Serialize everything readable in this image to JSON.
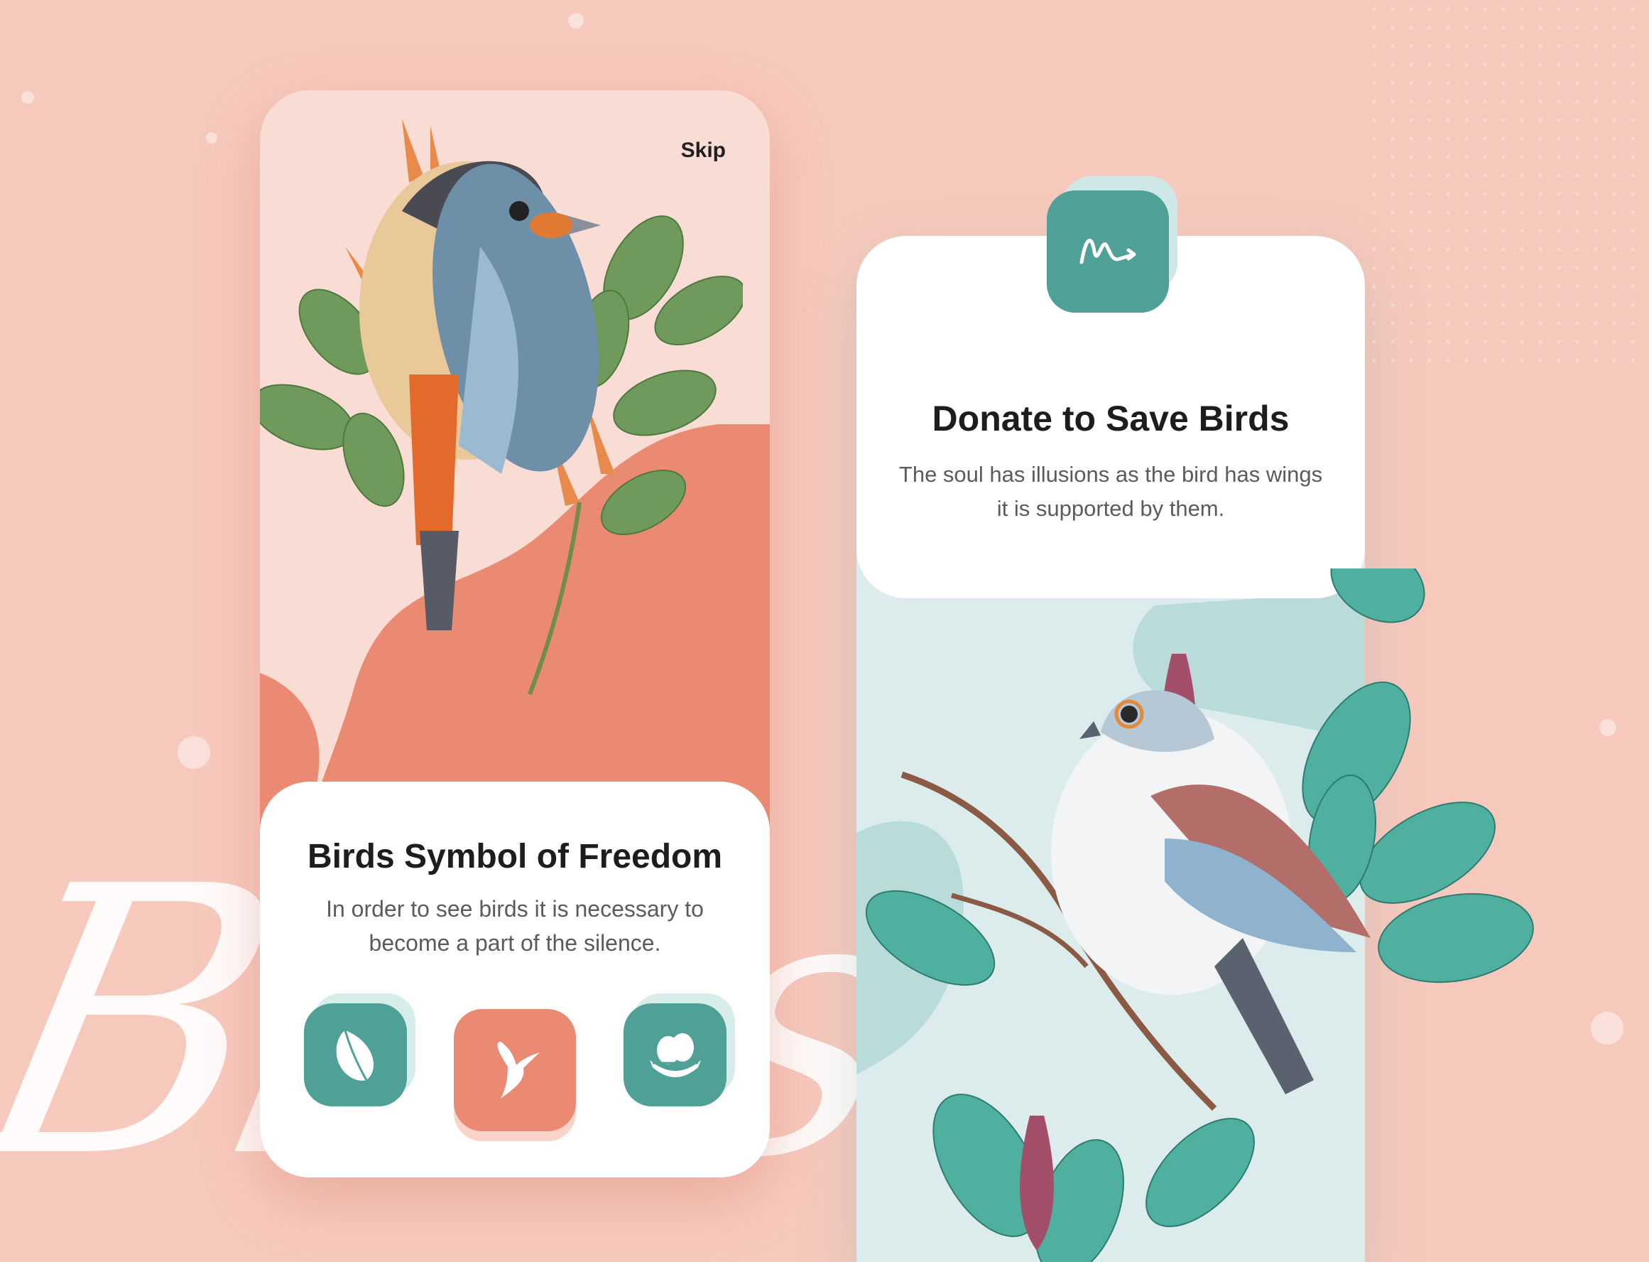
{
  "background": {
    "script_text": "Birds",
    "color": "#f7c9bd"
  },
  "onboarding": {
    "skip_label": "Skip",
    "title": "Birds Symbol of Freedom",
    "description": "In order to see birds it is necessary to become a part of the silence.",
    "icons": [
      {
        "name": "feather-icon",
        "color": "#4fa197"
      },
      {
        "name": "hummingbird-icon",
        "color": "#eb8a73"
      },
      {
        "name": "nest-eggs-icon",
        "color": "#4fa197"
      }
    ]
  },
  "donate": {
    "title": "Donate to Save Birds",
    "description": "The soul has illusions as the bird has wings it is supported by them.",
    "badge_icon": "signature-icon",
    "accent": "#4fa197"
  }
}
